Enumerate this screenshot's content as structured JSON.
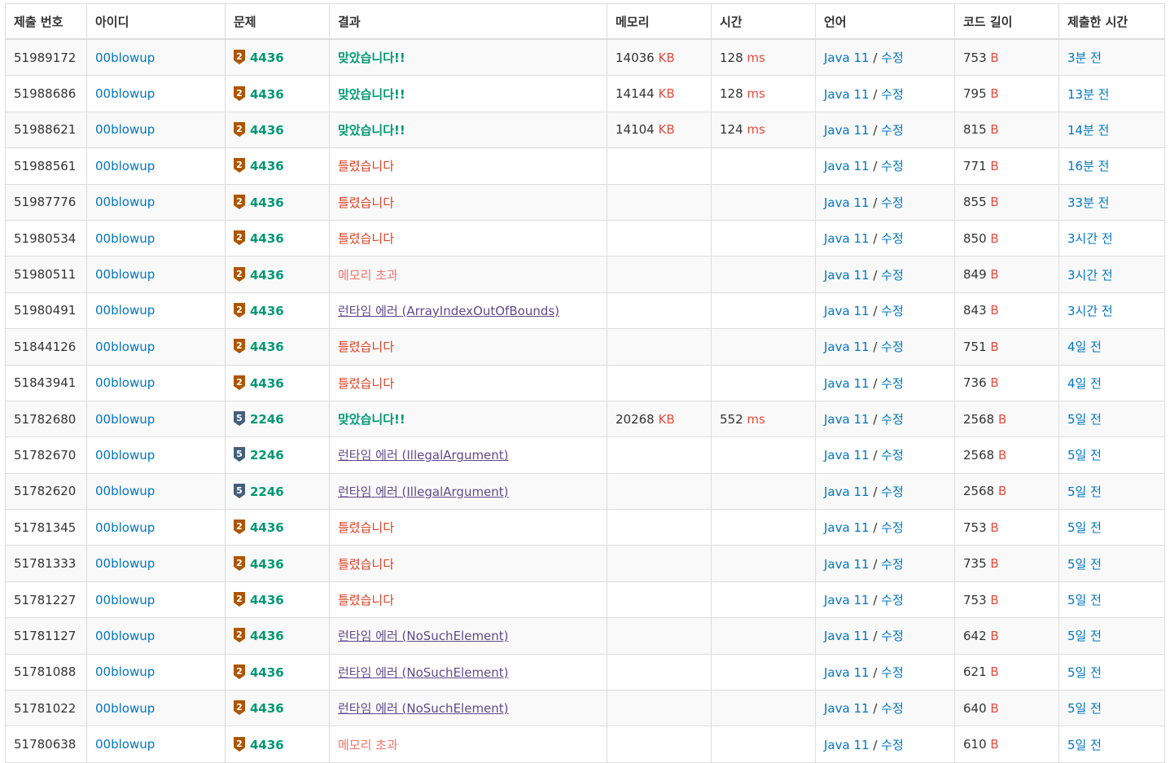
{
  "headers": [
    "제출 번호",
    "아이디",
    "문제",
    "결과",
    "메모리",
    "시간",
    "언어",
    "코드 길이",
    "제출한 시간"
  ],
  "units": {
    "memory": "KB",
    "time": "ms",
    "code": "B"
  },
  "edit_label": "수정",
  "colors": {
    "bronze": "#ad5600",
    "silver": "#435f7a",
    "accepted": "#009874",
    "wrong": "#dd4124",
    "mle": "#fa7268",
    "rte": "#5f4b8b",
    "link": "#0076c0",
    "unit": "#e74c3c"
  },
  "rows": [
    {
      "id": "51989172",
      "user": "00blowup",
      "tier": "2",
      "tier_color": "bronze",
      "problem": "4436",
      "result": "맞았습니다!!",
      "rtype": "ac",
      "memory": "14036",
      "time": "128",
      "lang": "Java 11",
      "length": "753",
      "when": "3분 전"
    },
    {
      "id": "51988686",
      "user": "00blowup",
      "tier": "2",
      "tier_color": "bronze",
      "problem": "4436",
      "result": "맞았습니다!!",
      "rtype": "ac",
      "memory": "14144",
      "time": "128",
      "lang": "Java 11",
      "length": "795",
      "when": "13분 전"
    },
    {
      "id": "51988621",
      "user": "00blowup",
      "tier": "2",
      "tier_color": "bronze",
      "problem": "4436",
      "result": "맞았습니다!!",
      "rtype": "ac",
      "memory": "14104",
      "time": "124",
      "lang": "Java 11",
      "length": "815",
      "when": "14분 전"
    },
    {
      "id": "51988561",
      "user": "00blowup",
      "tier": "2",
      "tier_color": "bronze",
      "problem": "4436",
      "result": "틀렸습니다",
      "rtype": "wa",
      "memory": "",
      "time": "",
      "lang": "Java 11",
      "length": "771",
      "when": "16분 전"
    },
    {
      "id": "51987776",
      "user": "00blowup",
      "tier": "2",
      "tier_color": "bronze",
      "problem": "4436",
      "result": "틀렸습니다",
      "rtype": "wa",
      "memory": "",
      "time": "",
      "lang": "Java 11",
      "length": "855",
      "when": "33분 전"
    },
    {
      "id": "51980534",
      "user": "00blowup",
      "tier": "2",
      "tier_color": "bronze",
      "problem": "4436",
      "result": "틀렸습니다",
      "rtype": "wa",
      "memory": "",
      "time": "",
      "lang": "Java 11",
      "length": "850",
      "when": "3시간 전"
    },
    {
      "id": "51980511",
      "user": "00blowup",
      "tier": "2",
      "tier_color": "bronze",
      "problem": "4436",
      "result": "메모리 초과",
      "rtype": "mle",
      "memory": "",
      "time": "",
      "lang": "Java 11",
      "length": "849",
      "when": "3시간 전"
    },
    {
      "id": "51980491",
      "user": "00blowup",
      "tier": "2",
      "tier_color": "bronze",
      "problem": "4436",
      "result": "런타임 에러 (ArrayIndexOutOfBounds)",
      "rtype": "rte",
      "memory": "",
      "time": "",
      "lang": "Java 11",
      "length": "843",
      "when": "3시간 전"
    },
    {
      "id": "51844126",
      "user": "00blowup",
      "tier": "2",
      "tier_color": "bronze",
      "problem": "4436",
      "result": "틀렸습니다",
      "rtype": "wa",
      "memory": "",
      "time": "",
      "lang": "Java 11",
      "length": "751",
      "when": "4일 전"
    },
    {
      "id": "51843941",
      "user": "00blowup",
      "tier": "2",
      "tier_color": "bronze",
      "problem": "4436",
      "result": "틀렸습니다",
      "rtype": "wa",
      "memory": "",
      "time": "",
      "lang": "Java 11",
      "length": "736",
      "when": "4일 전"
    },
    {
      "id": "51782680",
      "user": "00blowup",
      "tier": "5",
      "tier_color": "silver",
      "problem": "2246",
      "result": "맞았습니다!!",
      "rtype": "ac",
      "memory": "20268",
      "time": "552",
      "lang": "Java 11",
      "length": "2568",
      "when": "5일 전"
    },
    {
      "id": "51782670",
      "user": "00blowup",
      "tier": "5",
      "tier_color": "silver",
      "problem": "2246",
      "result": "런타임 에러 (IllegalArgument)",
      "rtype": "rte",
      "memory": "",
      "time": "",
      "lang": "Java 11",
      "length": "2568",
      "when": "5일 전"
    },
    {
      "id": "51782620",
      "user": "00blowup",
      "tier": "5",
      "tier_color": "silver",
      "problem": "2246",
      "result": "런타임 에러 (IllegalArgument)",
      "rtype": "rte",
      "memory": "",
      "time": "",
      "lang": "Java 11",
      "length": "2568",
      "when": "5일 전"
    },
    {
      "id": "51781345",
      "user": "00blowup",
      "tier": "2",
      "tier_color": "bronze",
      "problem": "4436",
      "result": "틀렸습니다",
      "rtype": "wa",
      "memory": "",
      "time": "",
      "lang": "Java 11",
      "length": "753",
      "when": "5일 전"
    },
    {
      "id": "51781333",
      "user": "00blowup",
      "tier": "2",
      "tier_color": "bronze",
      "problem": "4436",
      "result": "틀렸습니다",
      "rtype": "wa",
      "memory": "",
      "time": "",
      "lang": "Java 11",
      "length": "735",
      "when": "5일 전"
    },
    {
      "id": "51781227",
      "user": "00blowup",
      "tier": "2",
      "tier_color": "bronze",
      "problem": "4436",
      "result": "틀렸습니다",
      "rtype": "wa",
      "memory": "",
      "time": "",
      "lang": "Java 11",
      "length": "753",
      "when": "5일 전"
    },
    {
      "id": "51781127",
      "user": "00blowup",
      "tier": "2",
      "tier_color": "bronze",
      "problem": "4436",
      "result": "런타임 에러 (NoSuchElement)",
      "rtype": "rte",
      "memory": "",
      "time": "",
      "lang": "Java 11",
      "length": "642",
      "when": "5일 전"
    },
    {
      "id": "51781088",
      "user": "00blowup",
      "tier": "2",
      "tier_color": "bronze",
      "problem": "4436",
      "result": "런타임 에러 (NoSuchElement)",
      "rtype": "rte",
      "memory": "",
      "time": "",
      "lang": "Java 11",
      "length": "621",
      "when": "5일 전"
    },
    {
      "id": "51781022",
      "user": "00blowup",
      "tier": "2",
      "tier_color": "bronze",
      "problem": "4436",
      "result": "런타임 에러 (NoSuchElement)",
      "rtype": "rte",
      "memory": "",
      "time": "",
      "lang": "Java 11",
      "length": "640",
      "when": "5일 전"
    },
    {
      "id": "51780638",
      "user": "00blowup",
      "tier": "2",
      "tier_color": "bronze",
      "problem": "4436",
      "result": "메모리 초과",
      "rtype": "mle",
      "memory": "",
      "time": "",
      "lang": "Java 11",
      "length": "610",
      "when": "5일 전"
    }
  ]
}
